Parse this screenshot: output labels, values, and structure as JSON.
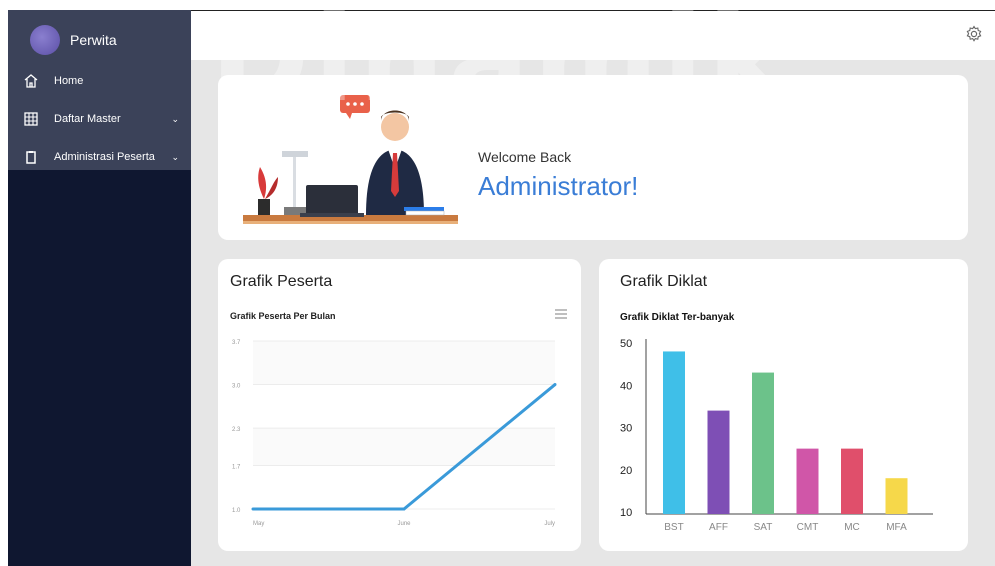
{
  "watermark": "Dinamik",
  "sidebar": {
    "brand": "Perwita",
    "items": [
      {
        "label": "Home",
        "icon": "home-icon",
        "has_submenu": false
      },
      {
        "label": "Daftar Master",
        "icon": "grid-icon",
        "has_submenu": true
      },
      {
        "label": "Administrasi Peserta",
        "icon": "clipboard-icon",
        "has_submenu": true
      }
    ]
  },
  "topbar": {
    "settings_icon": "gear-icon"
  },
  "welcome": {
    "subtitle": "Welcome Back",
    "name": "Administrator!"
  },
  "cards": {
    "left_title": "Grafik Peserta",
    "right_title": "Grafik Diklat"
  },
  "colors": {
    "sidebar_bg": "#0f1730",
    "sidebar_top": "#3b4259",
    "accent_blue": "#3a7dd6",
    "line_color": "#3a9ad9"
  },
  "chart_data": [
    {
      "type": "line",
      "title": "Grafik Peserta Per Bulan",
      "categories": [
        "May",
        "June",
        "July"
      ],
      "series": [
        {
          "values": [
            1.0,
            1.0,
            3.0
          ]
        }
      ],
      "yticks": [
        "3.7",
        "3.0",
        "2.3",
        "1.7",
        "1.0"
      ],
      "ylim": [
        1.0,
        3.7
      ],
      "grid": true
    },
    {
      "type": "bar",
      "title": "Grafik Diklat Ter-banyak",
      "categories": [
        "BST",
        "AFF",
        "SAT",
        "CMT",
        "MC",
        "MFA"
      ],
      "values": [
        48,
        34,
        43,
        25,
        25,
        18
      ],
      "bar_colors": [
        "#3fbfe8",
        "#7e4fb5",
        "#6cc28a",
        "#d056a8",
        "#e04f6b",
        "#f6d84a"
      ],
      "yticks": [
        "50",
        "40",
        "30",
        "20",
        "10"
      ],
      "ylim": [
        10,
        50
      ]
    }
  ]
}
